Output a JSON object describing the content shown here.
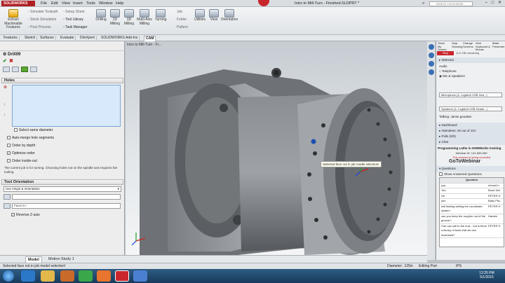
{
  "app": {
    "logo_text": "SOLIDWORKS",
    "doc_title": "Intro to Mill-Turn - Finished.SLDPRT *",
    "search_placeholder": "Search Commands",
    "window_controls": "– □ ✕"
  },
  "menu": [
    "File",
    "Edit",
    "View",
    "Insert",
    "Tools",
    "Window",
    "Help"
  ],
  "ribbon": {
    "left_small": [
      "Extract Machinable Features",
      "Simulate Toolpath",
      "Stock Simulation",
      "Post Process",
      "Setup Sheet",
      "Tool Library",
      "Task Manager"
    ],
    "buttons": [
      "Drilling",
      "2D Milling",
      "3D Milling",
      "Multi-Axis Milling",
      "Turning"
    ],
    "right": [
      "Utilities",
      "View",
      "Orientation"
    ],
    "part_labels": [
      "Job",
      "Folder",
      "Pattern"
    ]
  },
  "tabs": [
    "Features",
    "Sketch",
    "Surfaces",
    "Evaluate",
    "DimXpert",
    "SOLIDWORKS Add-Ins",
    "CAM"
  ],
  "leftpanel": {
    "title": "Drill09",
    "holes_header": "Holes",
    "options": [
      {
        "label": "Select same diameter",
        "checked": false
      },
      {
        "label": "Auto-merge hole segments",
        "checked": false
      },
      {
        "label": "Order by depth",
        "checked": false
      },
      {
        "label": "Optimize order",
        "checked": true
      },
      {
        "label": "Order inside-out",
        "checked": false
      }
    ],
    "note": "The current job is for turning. Choosing holes not on the spindle axis requires live tooling.",
    "tool_orientation_header": "Tool Orientation",
    "orientation_select": "Use Origin & Orientation",
    "face_field": "Face<1>",
    "reverse_label": "Reverse Z-axis"
  },
  "viewport": {
    "doc_tab": "Intro to Mill-Turn - Fi...",
    "tooltip": "Selected face not in job model selection!"
  },
  "bottom_tabs": [
    "Model",
    "Motion Study 1"
  ],
  "status": {
    "message": "Selected face not in job model selection!",
    "diameter": "Diameter: .125in",
    "mode": "Editing Part",
    "units": "IPS"
  },
  "taskpane": {
    "top_labels": [
      "Show My Screen",
      "Stop Showing",
      "Change Screens",
      "Give Keyboard & Mouse",
      "Make Presenter"
    ],
    "stop_button": "Stop Presenting",
    "seconds": "11.6 GB remaining",
    "webcam": "Webcam",
    "audio": "Audio",
    "telephone": "Telephone",
    "mic": "Mic & Speakers",
    "mic_select": "Microphone (4- Logitech USB Hea...)",
    "speakers_select": "Speakers (4- Logitech USB Heads...)",
    "talking": "Talking: Jamie goodwin",
    "sections": [
      {
        "label": "Dashboard",
        "value": ""
      },
      {
        "label": "Attendees:",
        "value": "26 out of 101"
      },
      {
        "label": "Polls (0/0)",
        "value": ""
      },
      {
        "label": "Chat",
        "value": ""
      }
    ],
    "webinar_title": "Programming Lathe in HSMWorks training",
    "webinar_id": "Webinar ID: 131-839-259",
    "recording": "This session is being recorded",
    "brand": "GoToWebinar",
    "questions_header": "Questions",
    "show_answered": "Show Answered Questions",
    "question_col": "Question",
    "questions": [
      {
        "q": "yup",
        "a": "richard b"
      },
      {
        "q": "Yes",
        "a": "Bona Sch"
      },
      {
        "q": "Ok",
        "a": "PETER H"
      },
      {
        "q": "yes",
        "a": "Baby Pho"
      },
      {
        "q": "will tricking setting the coordinate system",
        "a": "PETER H"
      },
      {
        "q": "can you keep the rougher out of the groove?",
        "a": "Harden"
      },
      {
        "q": "Can can call to the end... but is there a library of tools that we can download?",
        "a": "PETER H"
      }
    ]
  },
  "taskbar": {
    "time": "12:25 PM",
    "date": "5/1/2015"
  }
}
